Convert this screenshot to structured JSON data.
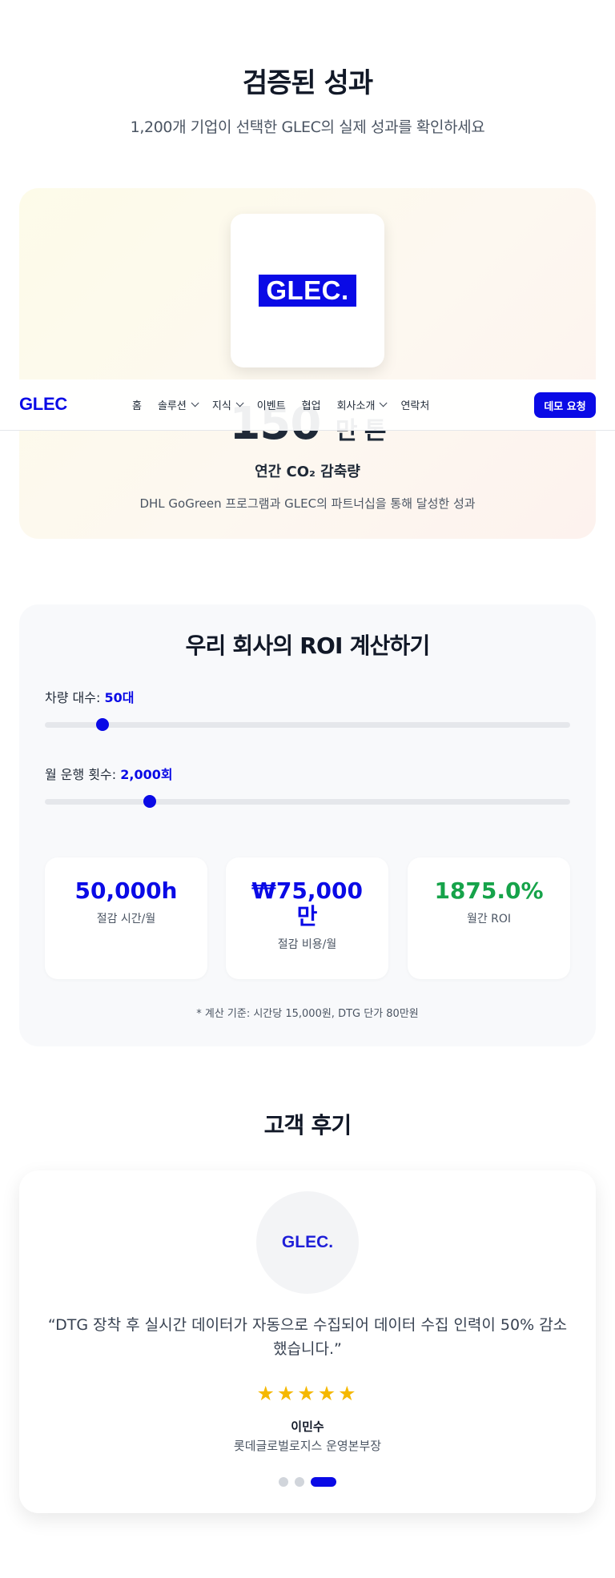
{
  "performance": {
    "title": "검증된 성과",
    "subtitle": "1,200개 기업이 선택한 GLEC의 실제 성과를 확인하세요",
    "logo_text": "GLEC.",
    "metric_value": "150",
    "metric_unit": "만 톤",
    "metric_label": "연간 CO₂ 감축량",
    "metric_description": "DHL GoGreen 프로그램과 GLEC의 파트너십을 통해 달성한 성과"
  },
  "navbar": {
    "logo": "GLEC",
    "items": [
      {
        "label": "홈",
        "has_dropdown": false
      },
      {
        "label": "솔루션",
        "has_dropdown": true
      },
      {
        "label": "지식",
        "has_dropdown": true
      },
      {
        "label": "이벤트",
        "has_dropdown": false
      },
      {
        "label": "협업",
        "has_dropdown": false
      },
      {
        "label": "회사소개",
        "has_dropdown": true
      },
      {
        "label": "연락처",
        "has_dropdown": false
      }
    ],
    "cta": "데모 요청"
  },
  "roi": {
    "title": "우리 회사의 ROI 계산하기",
    "vehicles": {
      "label": "차량 대수: ",
      "value": "50대",
      "fill": 0.11
    },
    "trips": {
      "label": "월 운행 횟수: ",
      "value": "2,000회",
      "fill": 0.2
    },
    "stats": [
      {
        "value": "50,000h",
        "label": "절감 시간/월",
        "color": "#0a0ae6"
      },
      {
        "value": "₩75,000만",
        "label": "절감 비용/월",
        "color": "#0a0ae6"
      },
      {
        "value": "1875.0%",
        "label": "월간 ROI",
        "color": "#16a34a"
      }
    ],
    "note": "* 계산 기준: 시간당 15,000원, DTG 단가 80만원"
  },
  "reviews": {
    "title": "고객 후기",
    "avatar_text": "GLEC.",
    "quote": "“DTG 장착 후 실시간 데이터가 자동으로 수집되어 데이터 수집 인력이 50% 감소했습니다.”",
    "rating": 5,
    "stars": "★★★★★",
    "name": "이민수",
    "role": "롯데글로벌로지스 운영본부장",
    "pagination_count": 3,
    "active_index": 2
  }
}
